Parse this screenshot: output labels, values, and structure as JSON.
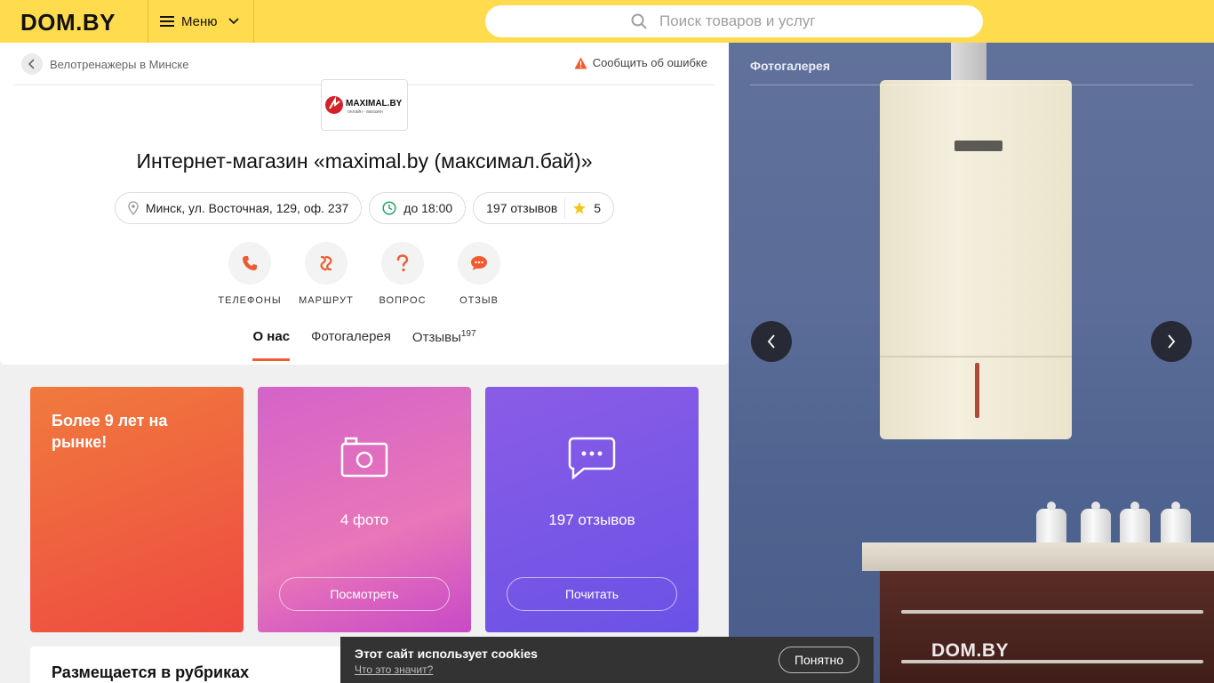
{
  "header": {
    "logo": "DOM.BY",
    "menu_label": "Меню",
    "search_placeholder": "Поиск товаров и услуг"
  },
  "breadcrumb": {
    "text": "Велотренажеры в Минске",
    "report": "Сообщить об ошибке"
  },
  "shop": {
    "logo_text": "MAXIMAL.BY",
    "logo_sub": "онлайн - магазин",
    "title": "Интернет-магазин «maximal.by (максимал.бай)»",
    "address": "Минск, ул. Восточная, 129, оф. 237",
    "hours": "до 18:00",
    "reviews": "197 отзывов",
    "rating": "5"
  },
  "actions": [
    {
      "label": "ТЕЛЕФОНЫ"
    },
    {
      "label": "МАРШРУТ"
    },
    {
      "label": "ВОПРОС"
    },
    {
      "label": "ОТЗЫВ"
    }
  ],
  "tabs": [
    {
      "label": "О нас"
    },
    {
      "label": "Фотогалерея"
    },
    {
      "label": "Отзывы",
      "count": "197"
    }
  ],
  "tiles": {
    "years": "Более 9 лет на рынке!",
    "photos_caption": "4 фото",
    "photos_button": "Посмотреть",
    "reviews_caption": "197 отзывов",
    "reviews_button": "Почитать"
  },
  "rubrics": {
    "title": "Размещается в рубриках"
  },
  "gallery": {
    "title": "Фотогалерея",
    "watermark": "DOM.BY"
  },
  "cookie": {
    "title": "Этот сайт использует cookies",
    "link": "Что это значит?",
    "button": "Понятно"
  },
  "colors": {
    "header_bg": "#ffdb4d",
    "accent": "#ef5a2e",
    "tile_orange": "#ee5a40",
    "tile_pink": "#d563c9",
    "tile_purple": "#7a56e6"
  }
}
